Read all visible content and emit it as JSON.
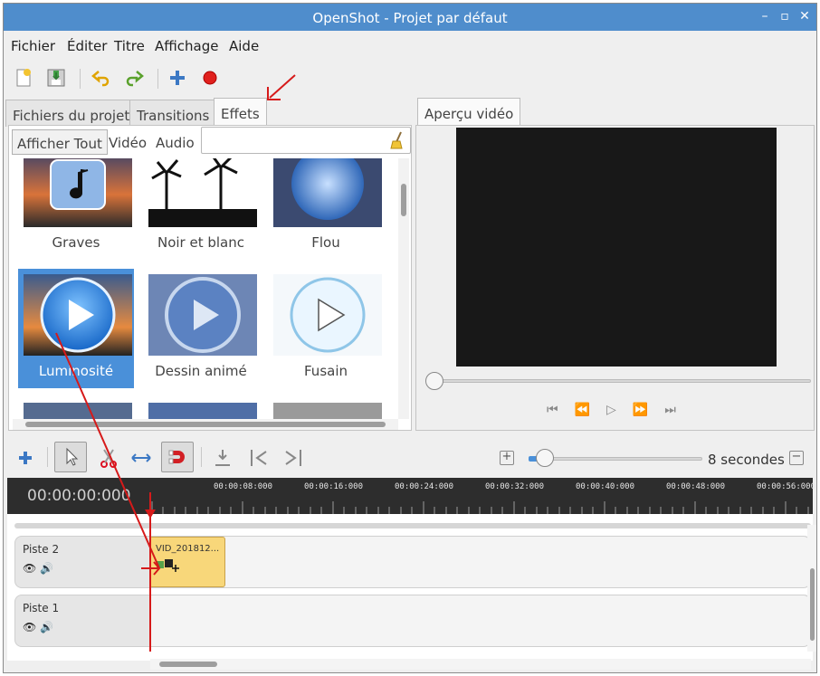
{
  "window": {
    "title": "OpenShot - Projet par défaut"
  },
  "menu": [
    "Fichier",
    "Éditer",
    "Titre",
    "Affichage",
    "Aide"
  ],
  "left_tabs": [
    "Fichiers du projet",
    "Transitions",
    "Effets"
  ],
  "filters": [
    "Afficher Tout",
    "Vidéo",
    "Audio"
  ],
  "search": {
    "value": "",
    "placeholder": ""
  },
  "effects": [
    {
      "label": "Graves"
    },
    {
      "label": "Noir et blanc"
    },
    {
      "label": "Flou"
    },
    {
      "label": "Luminosité",
      "selected": true
    },
    {
      "label": "Dessin animé"
    },
    {
      "label": "Fusain"
    }
  ],
  "preview": {
    "tab": "Aperçu vidéo"
  },
  "timeline": {
    "zoom_label": "8 secondes",
    "timecode": "00:00:00:000",
    "ticks": [
      "00:00:08:000",
      "00:00:16:000",
      "00:00:24:000",
      "00:00:32:000",
      "00:00:40:000",
      "00:00:48:000",
      "00:00:56:000"
    ],
    "tracks": [
      {
        "name": "Piste 2"
      },
      {
        "name": "Piste 1"
      }
    ],
    "clip": {
      "label": "VID_201812..."
    }
  },
  "colors": {
    "titlebar": "#4f8dcc",
    "selection": "#4a90d9",
    "clip": "#f8d77a",
    "playhead": "#d61a1a",
    "annotation": "#d61a1a"
  }
}
